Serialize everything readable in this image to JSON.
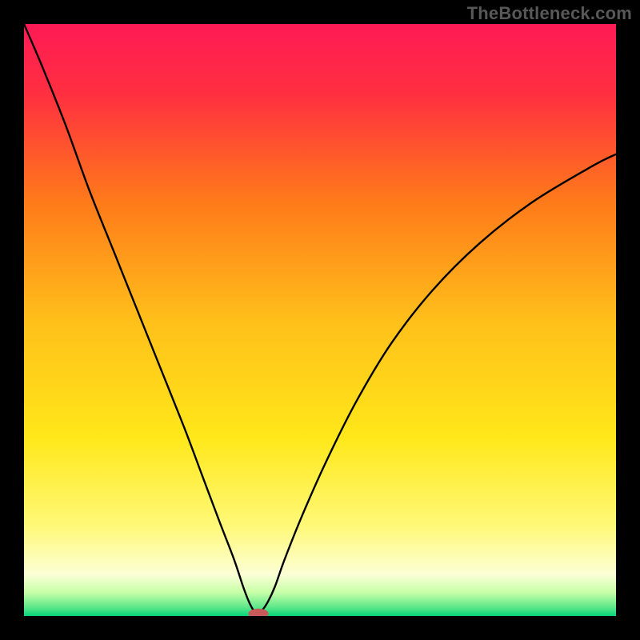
{
  "watermark": "TheBottleneck.com",
  "chart_data": {
    "type": "line",
    "title": "",
    "xlabel": "",
    "ylabel": "",
    "xlim": [
      0,
      100
    ],
    "ylim": [
      0,
      100
    ],
    "grid": false,
    "background_gradient": {
      "stops": [
        {
          "offset": 0,
          "color": "#ff1a55"
        },
        {
          "offset": 0.12,
          "color": "#ff3040"
        },
        {
          "offset": 0.3,
          "color": "#ff7a1a"
        },
        {
          "offset": 0.5,
          "color": "#ffbf1a"
        },
        {
          "offset": 0.7,
          "color": "#ffe81a"
        },
        {
          "offset": 0.85,
          "color": "#fff97a"
        },
        {
          "offset": 0.93,
          "color": "#fcffd6"
        },
        {
          "offset": 0.96,
          "color": "#c7ffa8"
        },
        {
          "offset": 0.985,
          "color": "#5fe88a"
        },
        {
          "offset": 1.0,
          "color": "#06d47a"
        }
      ]
    },
    "series": [
      {
        "name": "curve",
        "x": [
          0,
          3,
          7,
          11,
          15,
          19,
          23,
          27,
          30,
          33,
          35.5,
          37,
          38,
          38.8,
          39.5,
          40.2,
          41.2,
          42.4,
          44,
          47,
          51,
          56,
          62,
          69,
          77,
          86,
          96,
          100
        ],
        "y": [
          100,
          93,
          83,
          72,
          62,
          52,
          42,
          32,
          24,
          16,
          9.5,
          5,
          2.4,
          0.9,
          0.2,
          0.9,
          2.4,
          5,
          9.5,
          17,
          26,
          36,
          46,
          55,
          63,
          70,
          76,
          78
        ]
      }
    ],
    "marker": {
      "x": 39.6,
      "y": 0.4,
      "rx": 1.7,
      "ry": 0.85,
      "color": "#c85a5a"
    },
    "colors": {
      "curve": "#000000"
    }
  }
}
